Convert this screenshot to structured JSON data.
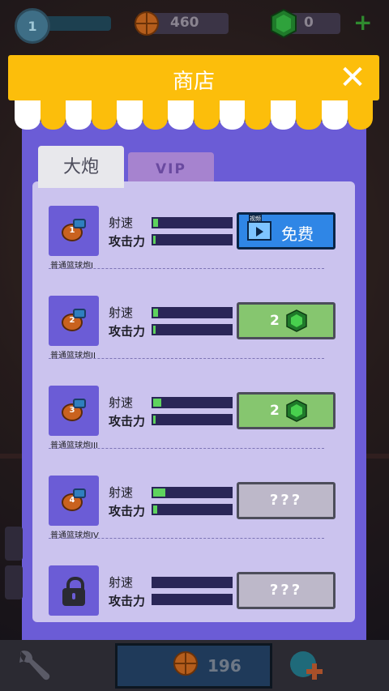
{
  "hud": {
    "level": "1",
    "coins": "460",
    "gems": "0",
    "plus_icon": "plus-icon"
  },
  "shop": {
    "title": "商店",
    "close_icon": "close-icon",
    "tabs": [
      {
        "label": "大炮",
        "active": true
      },
      {
        "label": "VIP",
        "active": false
      }
    ],
    "stat_labels": {
      "speed": "射速",
      "power": "攻击力"
    },
    "items": [
      {
        "name": "普通篮球炮I",
        "icon_number": "1",
        "speed": 0.06,
        "power": 0.03,
        "button": {
          "type": "free",
          "video_tag": "视频",
          "label": "免费"
        }
      },
      {
        "name": "普通篮球炮II",
        "icon_number": "2",
        "speed": 0.06,
        "power": 0.03,
        "button": {
          "type": "gem",
          "label": "2"
        }
      },
      {
        "name": "普通篮球炮III",
        "icon_number": "3",
        "speed": 0.1,
        "power": 0.03,
        "button": {
          "type": "gem",
          "label": "2"
        }
      },
      {
        "name": "普通篮球炮IV",
        "icon_number": "4",
        "speed": 0.16,
        "power": 0.05,
        "button": {
          "type": "locked",
          "label": "???"
        }
      },
      {
        "name": "",
        "icon_number": "",
        "locked": true,
        "speed": 0,
        "power": 0,
        "button": {
          "type": "locked",
          "label": "???"
        }
      }
    ]
  },
  "bottom": {
    "count": "196",
    "wrench_icon": "wrench-icon",
    "add_icon": "add-gem-icon"
  },
  "colors": {
    "header": "#fcbe0b",
    "panel": "#6b5cd6",
    "list_bg": "#cbc3ee",
    "free_button": "#2f86e6",
    "gem_button": "#86c66f",
    "locked_button": "#bdb8c9",
    "bar_fill": "#5ed35e"
  }
}
